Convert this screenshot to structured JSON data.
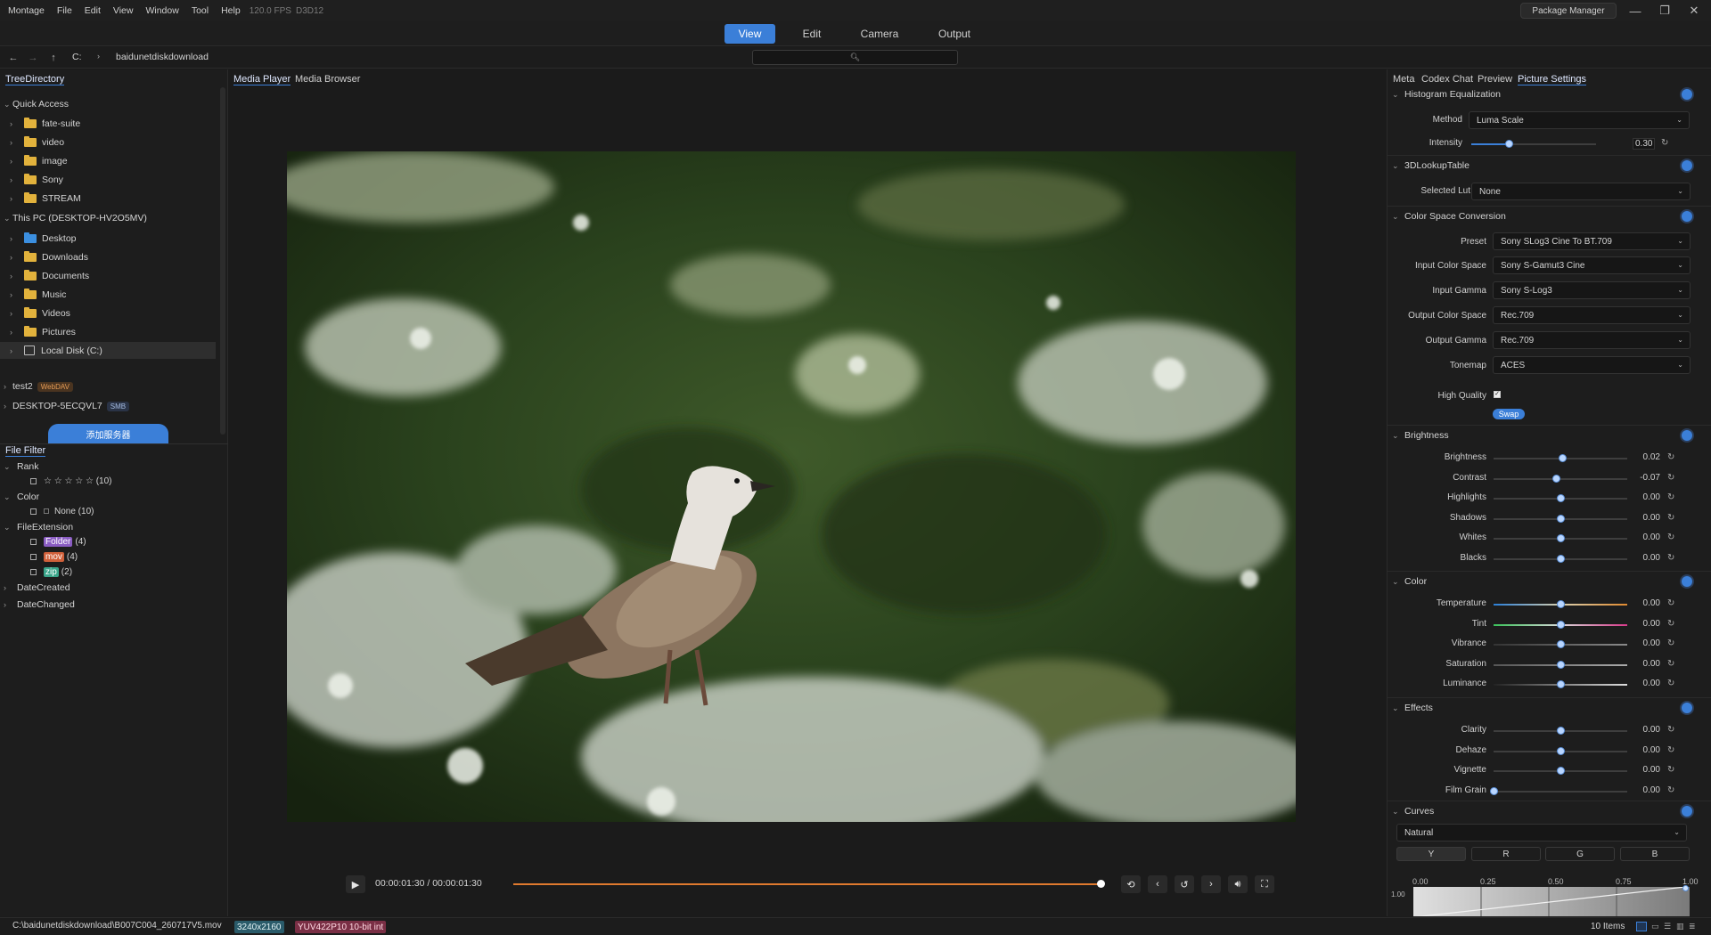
{
  "menubar": {
    "items": [
      "Montage",
      "File",
      "Edit",
      "View",
      "Window",
      "Tool",
      "Help"
    ],
    "fps": "120.0 FPS",
    "api": "D3D12",
    "package_manager": "Package Manager"
  },
  "modes": [
    "View",
    "Edit",
    "Camera",
    "Output"
  ],
  "pathbar": {
    "drive": "C:",
    "folder": "baidunetdiskdownload"
  },
  "left": {
    "tab": "TreeDirectory",
    "quick_access": {
      "title": "Quick Access",
      "items": [
        "fate-suite",
        "video",
        "image",
        "Sony",
        "STREAM"
      ]
    },
    "this_pc": {
      "title": "This PC (DESKTOP-HV2O5MV)",
      "items": [
        "Desktop",
        "Downloads",
        "Documents",
        "Music",
        "Videos",
        "Pictures",
        "Local Disk (C:)"
      ]
    },
    "servers": [
      {
        "name": "test2",
        "tag": "WebDAV"
      },
      {
        "name": "DESKTOP-5ECQVL7",
        "tag": "SMB"
      }
    ],
    "add_server": "添加服务器",
    "filter": {
      "tab": "File Filter",
      "rank": {
        "title": "Rank",
        "item": "☆ ☆ ☆ ☆ ☆ (10)"
      },
      "color": {
        "title": "Color",
        "item": "None (10)"
      },
      "ext": {
        "title": "FileExtension",
        "items": [
          {
            "name": "Folder",
            "count": "(4)",
            "color": "#8a5cc2"
          },
          {
            "name": "mov",
            "count": "(4)",
            "color": "#d0603a"
          },
          {
            "name": "zip",
            "count": "(2)",
            "color": "#3aa58a"
          }
        ]
      },
      "date_created": "DateCreated",
      "date_changed": "DateChanged"
    }
  },
  "center": {
    "tabs": [
      "Media Player",
      "Media Browser"
    ],
    "timecode": "00:00:01:30 / 00:00:01:30",
    "progress": 1.0
  },
  "right": {
    "tabs": [
      "Meta",
      "Codex Chat",
      "Preview",
      "Picture Settings"
    ],
    "histogram": {
      "title": "Histogram Equalization",
      "method_label": "Method",
      "method": "Luma Scale",
      "intensity_label": "Intensity",
      "intensity": "0.30",
      "intensity_pos": 0.3
    },
    "lut": {
      "title": "3DLookupTable",
      "selected_label": "Selected Lut",
      "selected": "None"
    },
    "csc": {
      "title": "Color Space Conversion",
      "rows": [
        {
          "label": "Preset",
          "value": "Sony SLog3 Cine To BT.709"
        },
        {
          "label": "Input Color Space",
          "value": "Sony S-Gamut3 Cine"
        },
        {
          "label": "Input Gamma",
          "value": "Sony S-Log3"
        },
        {
          "label": "Output Color Space",
          "value": "Rec.709"
        },
        {
          "label": "Output Gamma",
          "value": "Rec.709"
        },
        {
          "label": "Tonemap",
          "value": "ACES"
        }
      ],
      "high_quality": "High Quality",
      "swap": "Swap"
    },
    "brightness": {
      "title": "Brightness",
      "rows": [
        {
          "label": "Brightness",
          "value": "0.02",
          "pos": 0.51
        },
        {
          "label": "Contrast",
          "value": "-0.07",
          "pos": 0.465
        },
        {
          "label": "Highlights",
          "value": "0.00",
          "pos": 0.5
        },
        {
          "label": "Shadows",
          "value": "0.00",
          "pos": 0.5
        },
        {
          "label": "Whites",
          "value": "0.00",
          "pos": 0.5
        },
        {
          "label": "Blacks",
          "value": "0.00",
          "pos": 0.5
        }
      ]
    },
    "color": {
      "title": "Color",
      "rows": [
        {
          "label": "Temperature",
          "value": "0.00",
          "pos": 0.5
        },
        {
          "label": "Tint",
          "value": "0.00",
          "pos": 0.5
        },
        {
          "label": "Vibrance",
          "value": "0.00",
          "pos": 0.5
        },
        {
          "label": "Saturation",
          "value": "0.00",
          "pos": 0.5
        },
        {
          "label": "Luminance",
          "value": "0.00",
          "pos": 0.5
        }
      ]
    },
    "effects": {
      "title": "Effects",
      "rows": [
        {
          "label": "Clarity",
          "value": "0.00",
          "pos": 0.5
        },
        {
          "label": "Dehaze",
          "value": "0.00",
          "pos": 0.5
        },
        {
          "label": "Vignette",
          "value": "0.00",
          "pos": 0.5
        },
        {
          "label": "Film Grain",
          "value": "0.00",
          "pos": 0.0
        }
      ]
    },
    "curves": {
      "title": "Curves",
      "preset": "Natural",
      "channels": [
        "Y",
        "R",
        "G",
        "B"
      ],
      "ticks": [
        "0.00",
        "0.25",
        "0.50",
        "0.75",
        "1.00"
      ],
      "y_tick": "1.00"
    }
  },
  "status": {
    "path": "C:\\baidunetdiskdownload\\B007C004_260717V5.mov",
    "resolution": "3240x2160",
    "format": "YUV422P10 10-bit int",
    "items": "10 Items"
  },
  "colors": {
    "accent": "#3b7fd8",
    "timeline": "#e07a2e"
  }
}
